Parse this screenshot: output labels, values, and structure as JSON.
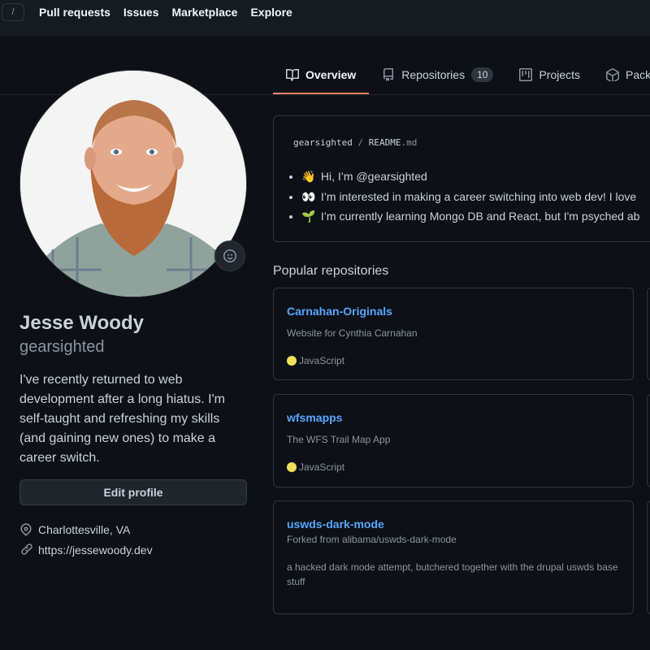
{
  "nav": {
    "slash": "/",
    "links": [
      "Pull requests",
      "Issues",
      "Marketplace",
      "Explore"
    ]
  },
  "tabs": [
    {
      "label": "Overview",
      "icon": "book-icon",
      "selected": true
    },
    {
      "label": "Repositories",
      "icon": "repo-icon",
      "count": "10"
    },
    {
      "label": "Projects",
      "icon": "project-icon"
    },
    {
      "label": "Packages",
      "icon": "package-icon"
    }
  ],
  "profile": {
    "name": "Jesse Woody",
    "login": "gearsighted",
    "bio": "I've recently returned to web development after a long hiatus. I'm self-taught and refreshing my skills (and gaining new ones) to make a career switch.",
    "edit_label": "Edit profile",
    "location": "Charlottesville, VA",
    "website": "https://jessewoody.dev"
  },
  "readme": {
    "owner": "gearsighted",
    "separator": "/",
    "file": "README",
    "ext": ".md",
    "items": [
      {
        "emoji": "👋",
        "text": "Hi, I’m @gearsighted"
      },
      {
        "emoji": "👀",
        "text": "I’m interested in making a career switching into web dev! I love"
      },
      {
        "emoji": "🌱",
        "text": "I’m currently learning Mongo DB and React, but I'm psyched ab"
      }
    ]
  },
  "popular_title": "Popular repositories",
  "repos": [
    {
      "name": "Carnahan-Originals",
      "description": "Website for Cynthia Carnahan",
      "language": "JavaScript",
      "lang_color": "#f1e05a"
    },
    {
      "name": "wfsmapps",
      "description": "The WFS Trail Map App",
      "language": "JavaScript",
      "lang_color": "#f1e05a"
    },
    {
      "name": "uswds-dark-mode",
      "forked": "Forked from alibama/uswds-dark-mode",
      "description_line1": "a hacked dark mode attempt, butchered together with the drupal uswds base",
      "description_line2": "stuff"
    }
  ],
  "colors": {
    "background": "#0d1117",
    "header": "#161b22",
    "link": "#58a6ff",
    "accent_underline": "#f78166",
    "border": "#30363d"
  }
}
